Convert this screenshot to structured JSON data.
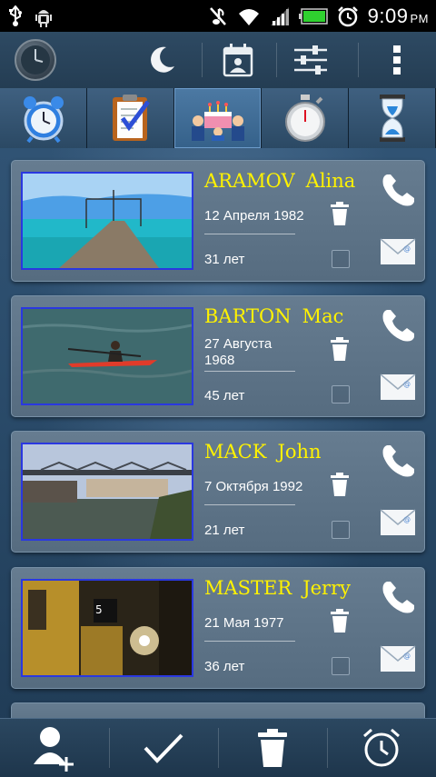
{
  "status_bar": {
    "time": "9:09",
    "ampm": "PM",
    "icons": [
      "usb-icon",
      "android-debug-icon",
      "mute-icon",
      "wifi-icon",
      "signal-icon",
      "battery-icon",
      "alarm-icon"
    ]
  },
  "action_bar": {
    "icons": [
      "analog-clock-icon",
      "night-mode-icon",
      "calendar-contact-icon",
      "settings-sliders-icon",
      "overflow-menu-icon"
    ]
  },
  "tabs": [
    {
      "name": "alarm-clock",
      "icon": "alarm-clock-icon",
      "active": false
    },
    {
      "name": "tasks",
      "icon": "clipboard-icon",
      "active": false
    },
    {
      "name": "birthdays",
      "icon": "birthday-cake-icon",
      "active": true
    },
    {
      "name": "stopwatch",
      "icon": "stopwatch-icon",
      "active": false
    },
    {
      "name": "timer",
      "icon": "hourglass-icon",
      "active": false
    }
  ],
  "contacts": [
    {
      "last": "ARAMOV",
      "first": "Alina",
      "birth_line1": "12 Апреля 1982",
      "birth_line2": "",
      "age": "31 лет",
      "photo": "pier-photo"
    },
    {
      "last": "BARTON",
      "first": "Mac",
      "birth_line1": "27 Августа",
      "birth_line2": "1968",
      "age": "45 лет",
      "photo": "kayak-photo"
    },
    {
      "last": "MACK",
      "first": "John",
      "birth_line1": "7 Октября 1992",
      "birth_line2": "",
      "age": "21 лет",
      "photo": "bridge-photo"
    },
    {
      "last": "MASTER",
      "first": "Jerry",
      "birth_line1": "21 Мая 1977",
      "birth_line2": "",
      "age": "36 лет",
      "photo": "subway-photo"
    }
  ],
  "bottom_bar": {
    "icons": [
      "add-contact-icon",
      "check-icon",
      "delete-icon",
      "alarm-icon"
    ]
  },
  "colors": {
    "name_text": "#fff200",
    "photo_border": "#2a38e0",
    "card_bg": "#62788c"
  }
}
